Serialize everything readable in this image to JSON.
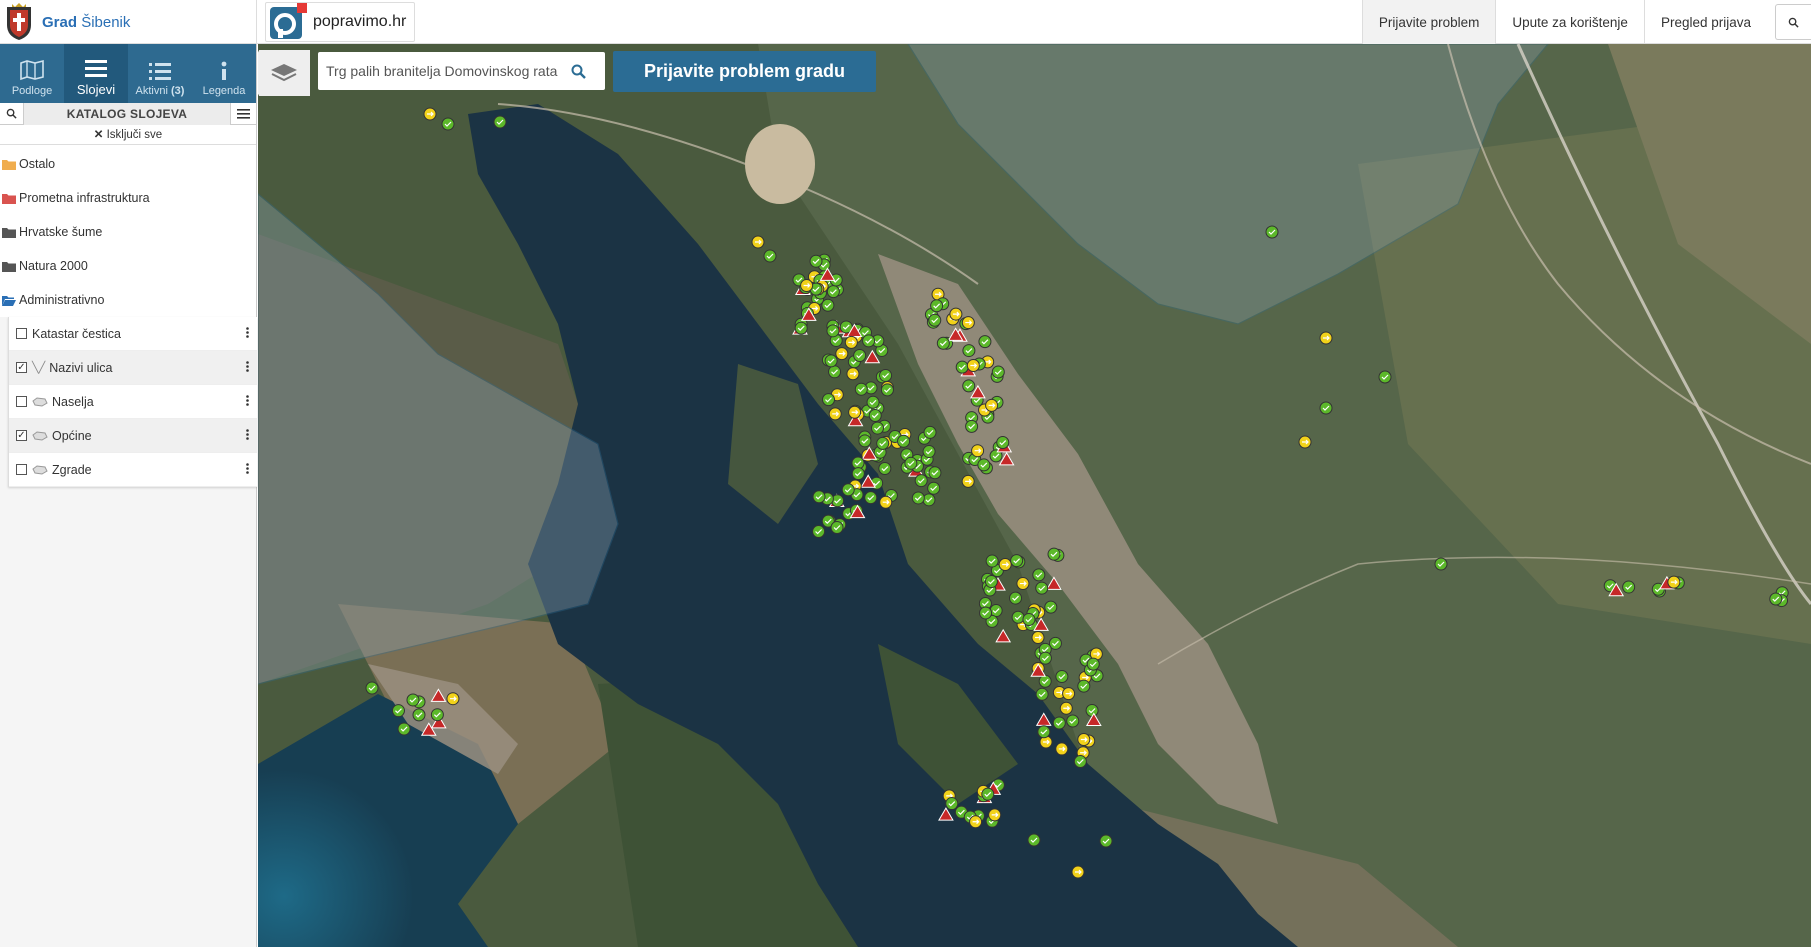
{
  "brand": {
    "city_bold": "Grad",
    "city_name": "Šibenik",
    "crest_icon": "city-crest-icon"
  },
  "popravimo": {
    "logo_icon": "popravimo-logo-icon",
    "label": "popravimo.hr"
  },
  "nav": {
    "report": "Prijavite problem",
    "instructions": "Upute za korištenje",
    "review": "Pregled prijava"
  },
  "tabs": {
    "basemaps": "Podloge",
    "layers": "Slojevi",
    "active": "Aktivni",
    "active_count": "(3)",
    "legend": "Legenda"
  },
  "catalog": {
    "title": "KATALOG SLOJEVA",
    "clear_all": "Isključi sve",
    "folders": [
      {
        "label": "Ostalo",
        "color": "#f0ad4e"
      },
      {
        "label": "Prometna infrastruktura",
        "color": "#d9534f"
      },
      {
        "label": "Hrvatske šume",
        "color": "#555555"
      },
      {
        "label": "Natura 2000",
        "color": "#555555"
      },
      {
        "label": "Administrativno",
        "color": "#2a6fb5"
      }
    ],
    "layers": [
      {
        "label": "Katastar čestica",
        "checked": false
      },
      {
        "label": "Nazivi ulica",
        "checked": true
      },
      {
        "label": "Naselja",
        "checked": false
      },
      {
        "label": "Općine",
        "checked": true
      },
      {
        "label": "Zgrade",
        "checked": false
      }
    ]
  },
  "map": {
    "search_value": "Trg palih branitelja Domovinskog rata",
    "report_button": "Prijavite problem gradu",
    "marker_colors": {
      "resolved": "#5cb82a",
      "in_progress": "#f2d21a",
      "reported": "#c62828"
    }
  }
}
